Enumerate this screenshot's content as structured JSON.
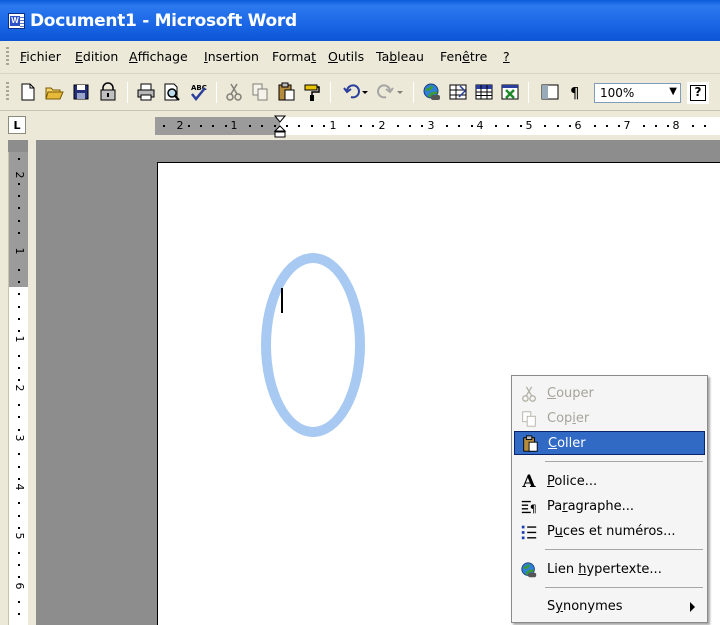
{
  "window": {
    "title": "Document1 - Microsoft Word",
    "app_icon": "word-icon"
  },
  "menubar": {
    "items": [
      {
        "pre": "",
        "key": "F",
        "post": "ichier"
      },
      {
        "pre": "",
        "key": "E",
        "post": "dition"
      },
      {
        "pre": "",
        "key": "A",
        "post": "ffichage"
      },
      {
        "pre": "",
        "key": "I",
        "post": "nsertion"
      },
      {
        "pre": "Forma",
        "key": "t",
        "post": ""
      },
      {
        "pre": "",
        "key": "O",
        "post": "utils"
      },
      {
        "pre": "Ta",
        "key": "b",
        "post": "leau"
      },
      {
        "pre": "Fen",
        "key": "ê",
        "post": "tre"
      },
      {
        "pre": "",
        "key": "?",
        "post": ""
      }
    ]
  },
  "toolbar": {
    "icons": [
      "new-document-icon",
      "open-folder-icon",
      "save-icon",
      "permission-icon",
      "print-icon",
      "print-preview-icon",
      "spelling-icon",
      "cut-icon",
      "copy-icon",
      "paste-icon",
      "format-painter-icon",
      "undo-icon",
      "redo-icon",
      "hyperlink-icon",
      "tables-borders-icon",
      "insert-table-icon",
      "insert-excel-icon"
    ],
    "zoom": "100%",
    "help": "?"
  },
  "ruler": {
    "tab_selector": "L",
    "h_labels": [
      "2",
      "1",
      "1",
      "2",
      "3",
      "4",
      "5",
      "6",
      "7",
      "8"
    ],
    "v_labels": [
      "2",
      "1",
      "1",
      "2",
      "3",
      "4",
      "5",
      "6"
    ]
  },
  "context_menu": {
    "items": [
      {
        "id": "couper",
        "icon": "scissors-icon",
        "pre": "",
        "key": "C",
        "post": "ouper",
        "state": "disabled"
      },
      {
        "id": "copier",
        "icon": "copy-icon",
        "pre": "Cop",
        "key": "i",
        "post": "er",
        "state": "disabled"
      },
      {
        "id": "coller",
        "icon": "paste-icon",
        "pre": "",
        "key": "C",
        "post": "oller",
        "state": "selected"
      },
      {
        "id": "police",
        "icon": "font-a-icon",
        "pre": "",
        "key": "P",
        "post": "olice...",
        "state": "normal"
      },
      {
        "id": "paragraphe",
        "icon": "paragraph-icon",
        "pre": "Pa",
        "key": "r",
        "post": "agraphe...",
        "state": "normal"
      },
      {
        "id": "puces",
        "icon": "bullets-numbering-icon",
        "pre": "P",
        "key": "u",
        "post": "ces et numéros...",
        "state": "normal"
      },
      {
        "id": "lien",
        "icon": "hyperlink-globe-icon",
        "pre": "Lien ",
        "key": "h",
        "post": "ypertexte...",
        "state": "normal"
      },
      {
        "id": "synonymes",
        "icon": "",
        "pre": "S",
        "key": "y",
        "post": "nonymes",
        "state": "normal",
        "submenu": true
      }
    ]
  },
  "colors": {
    "title_bar": "#0c55d6",
    "selection": "#316ac5",
    "highlight_ellipse": "#a7c9f2"
  }
}
